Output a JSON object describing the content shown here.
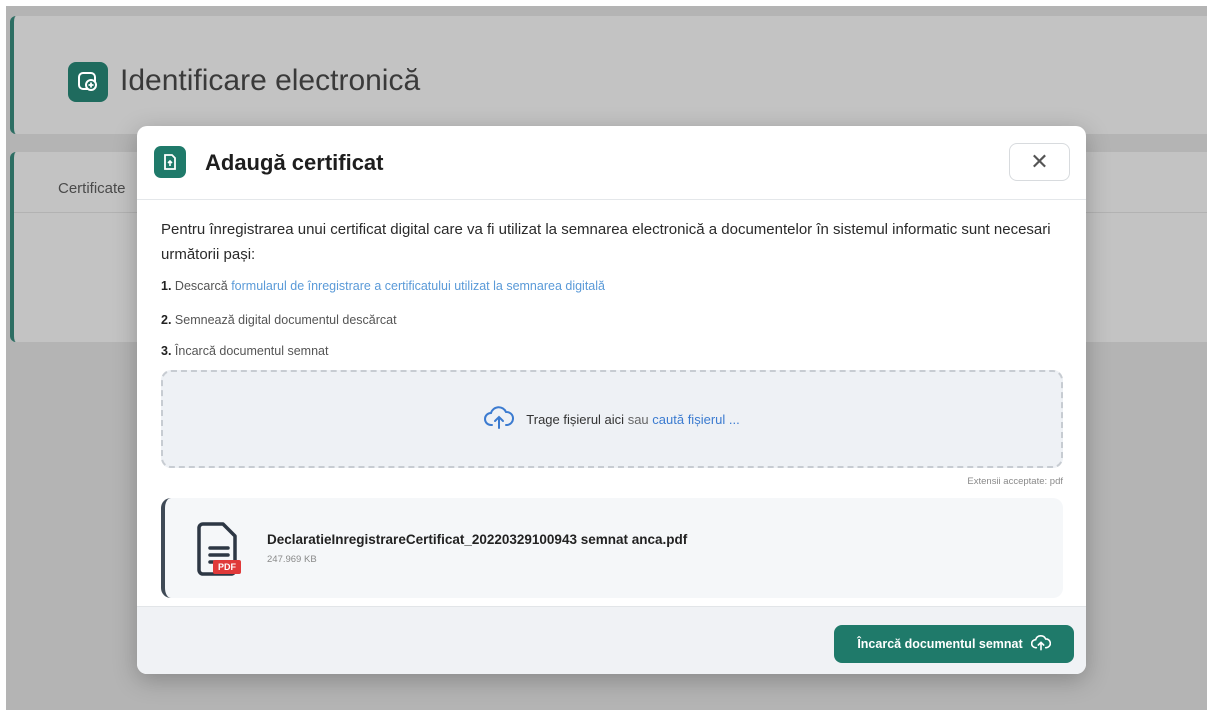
{
  "page": {
    "title": "Identificare electronică",
    "card_label": "Certificate"
  },
  "modal": {
    "title": "Adaugă certificat",
    "close_label": "✕",
    "intro": "Pentru înregistrarea unui certificat digital care va fi utilizat la semnarea electronică a documentelor în sistemul informatic sunt necesari următorii pași:",
    "steps": [
      {
        "num": "1.",
        "text": "Descarcă ",
        "link": "formularul de înregistrare a certificatului utilizat la semnarea digitală"
      },
      {
        "num": "2.",
        "text": "Semnează digital documentul descărcat"
      },
      {
        "num": "3.",
        "text": "Încarcă documentul semnat"
      }
    ],
    "dropzone": {
      "text": "Trage fișierul aici",
      "or": "sau",
      "link": "caută fișierul ..."
    },
    "accepted_ext": "Extensii acceptate: pdf",
    "file": {
      "name": "DeclaratieInregistrareCertificat_20220329100943 semnat anca.pdf",
      "size": "247.969 KB",
      "badge": "PDF"
    },
    "upload_button": "Încarcă documentul semnat"
  },
  "colors": {
    "accent": "#1f7a6a",
    "link": "#3b7bd0",
    "pdf_badge": "#e03a3a"
  },
  "icons": {
    "header": "shield-certificate-icon",
    "modal": "file-upload-icon",
    "dropzone": "cloud-upload-icon",
    "file": "document-icon",
    "button": "cloud-upload-icon"
  }
}
